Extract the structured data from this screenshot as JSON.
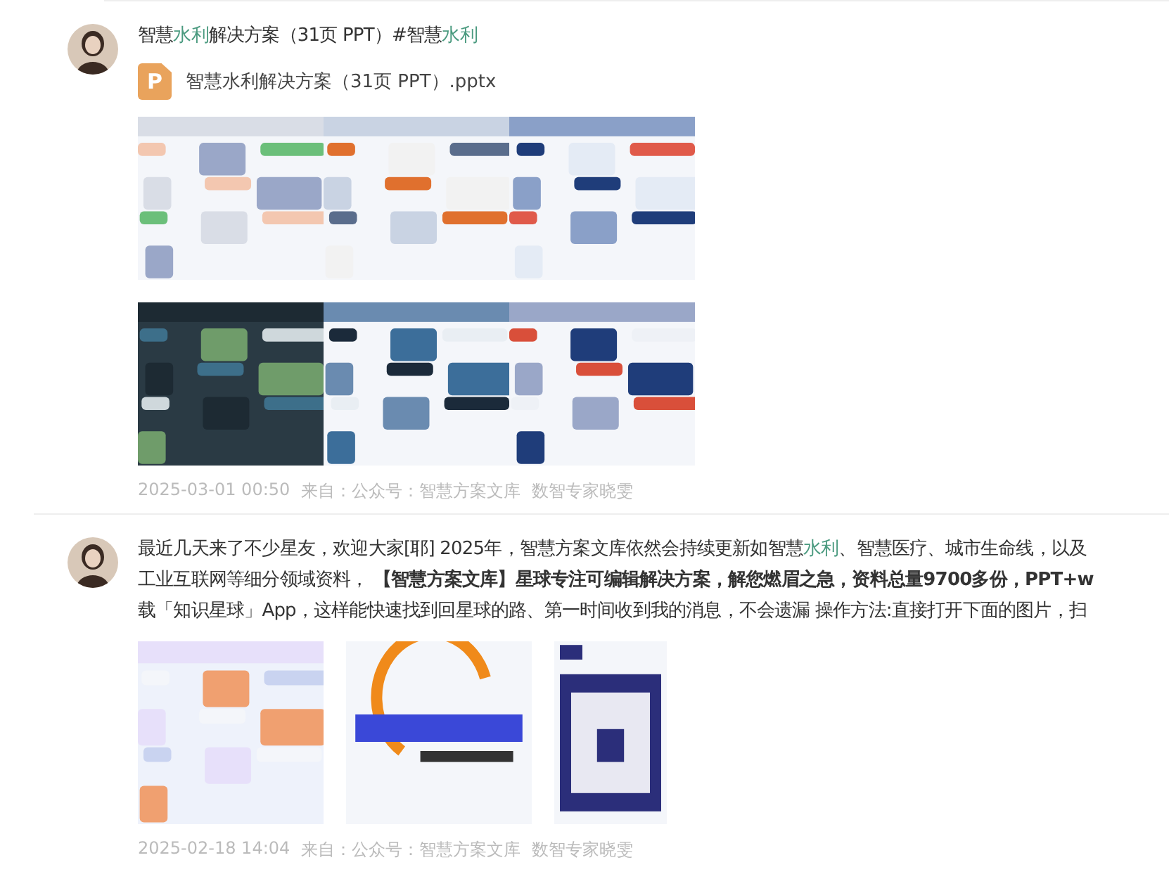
{
  "posts": [
    {
      "text_lines": [
        [
          {
            "text": "智慧"
          },
          {
            "text": "水利",
            "highlight": true
          },
          {
            "text": "解决方案（31页 PPT）#智慧"
          },
          {
            "text": "水利",
            "highlight": true
          }
        ]
      ],
      "file": {
        "badge": "P",
        "name": "智慧水利解决方案（31页 PPT）.pptx"
      },
      "images": [
        {
          "kind": "picture"
        },
        {
          "kind": "picture"
        },
        {
          "kind": "picture"
        },
        {
          "kind": "picture"
        },
        {
          "kind": "picture"
        },
        {
          "kind": "picture"
        }
      ],
      "time": "2025-03-01 00:50",
      "source": "来自：公众号：智慧方案文库",
      "author": "数智专家晓雯"
    },
    {
      "text_lines": [
        [
          {
            "text": "最近几天来了不少星友，欢迎大家[耶]  2025年，智慧方案文库依然会持续更新如智慧"
          },
          {
            "text": "水利",
            "highlight": true
          },
          {
            "text": "、智慧医疗、城市生命线，以及"
          }
        ],
        [
          {
            "text": "工业互联网等细分领域资料，  "
          },
          {
            "text": "【智慧方案文库】星球专注可编辑解决方案，解您燃眉之急，资料总量9700多份，PPT+w",
            "bold": true
          }
        ],
        [
          {
            "text": "载「知识星球」App，这样能快速找到回星球的路、第一时间收到我的消息，不会遗漏  操作方法:直接打开下面的图片，扫"
          }
        ]
      ],
      "images": [
        {
          "kind": "picture"
        },
        {
          "kind": "picture"
        },
        {
          "kind": "picture"
        }
      ],
      "time": "2025-02-18 14:04",
      "source": "来自：公众号：智慧方案文库",
      "author": "数智专家晓雯"
    }
  ]
}
